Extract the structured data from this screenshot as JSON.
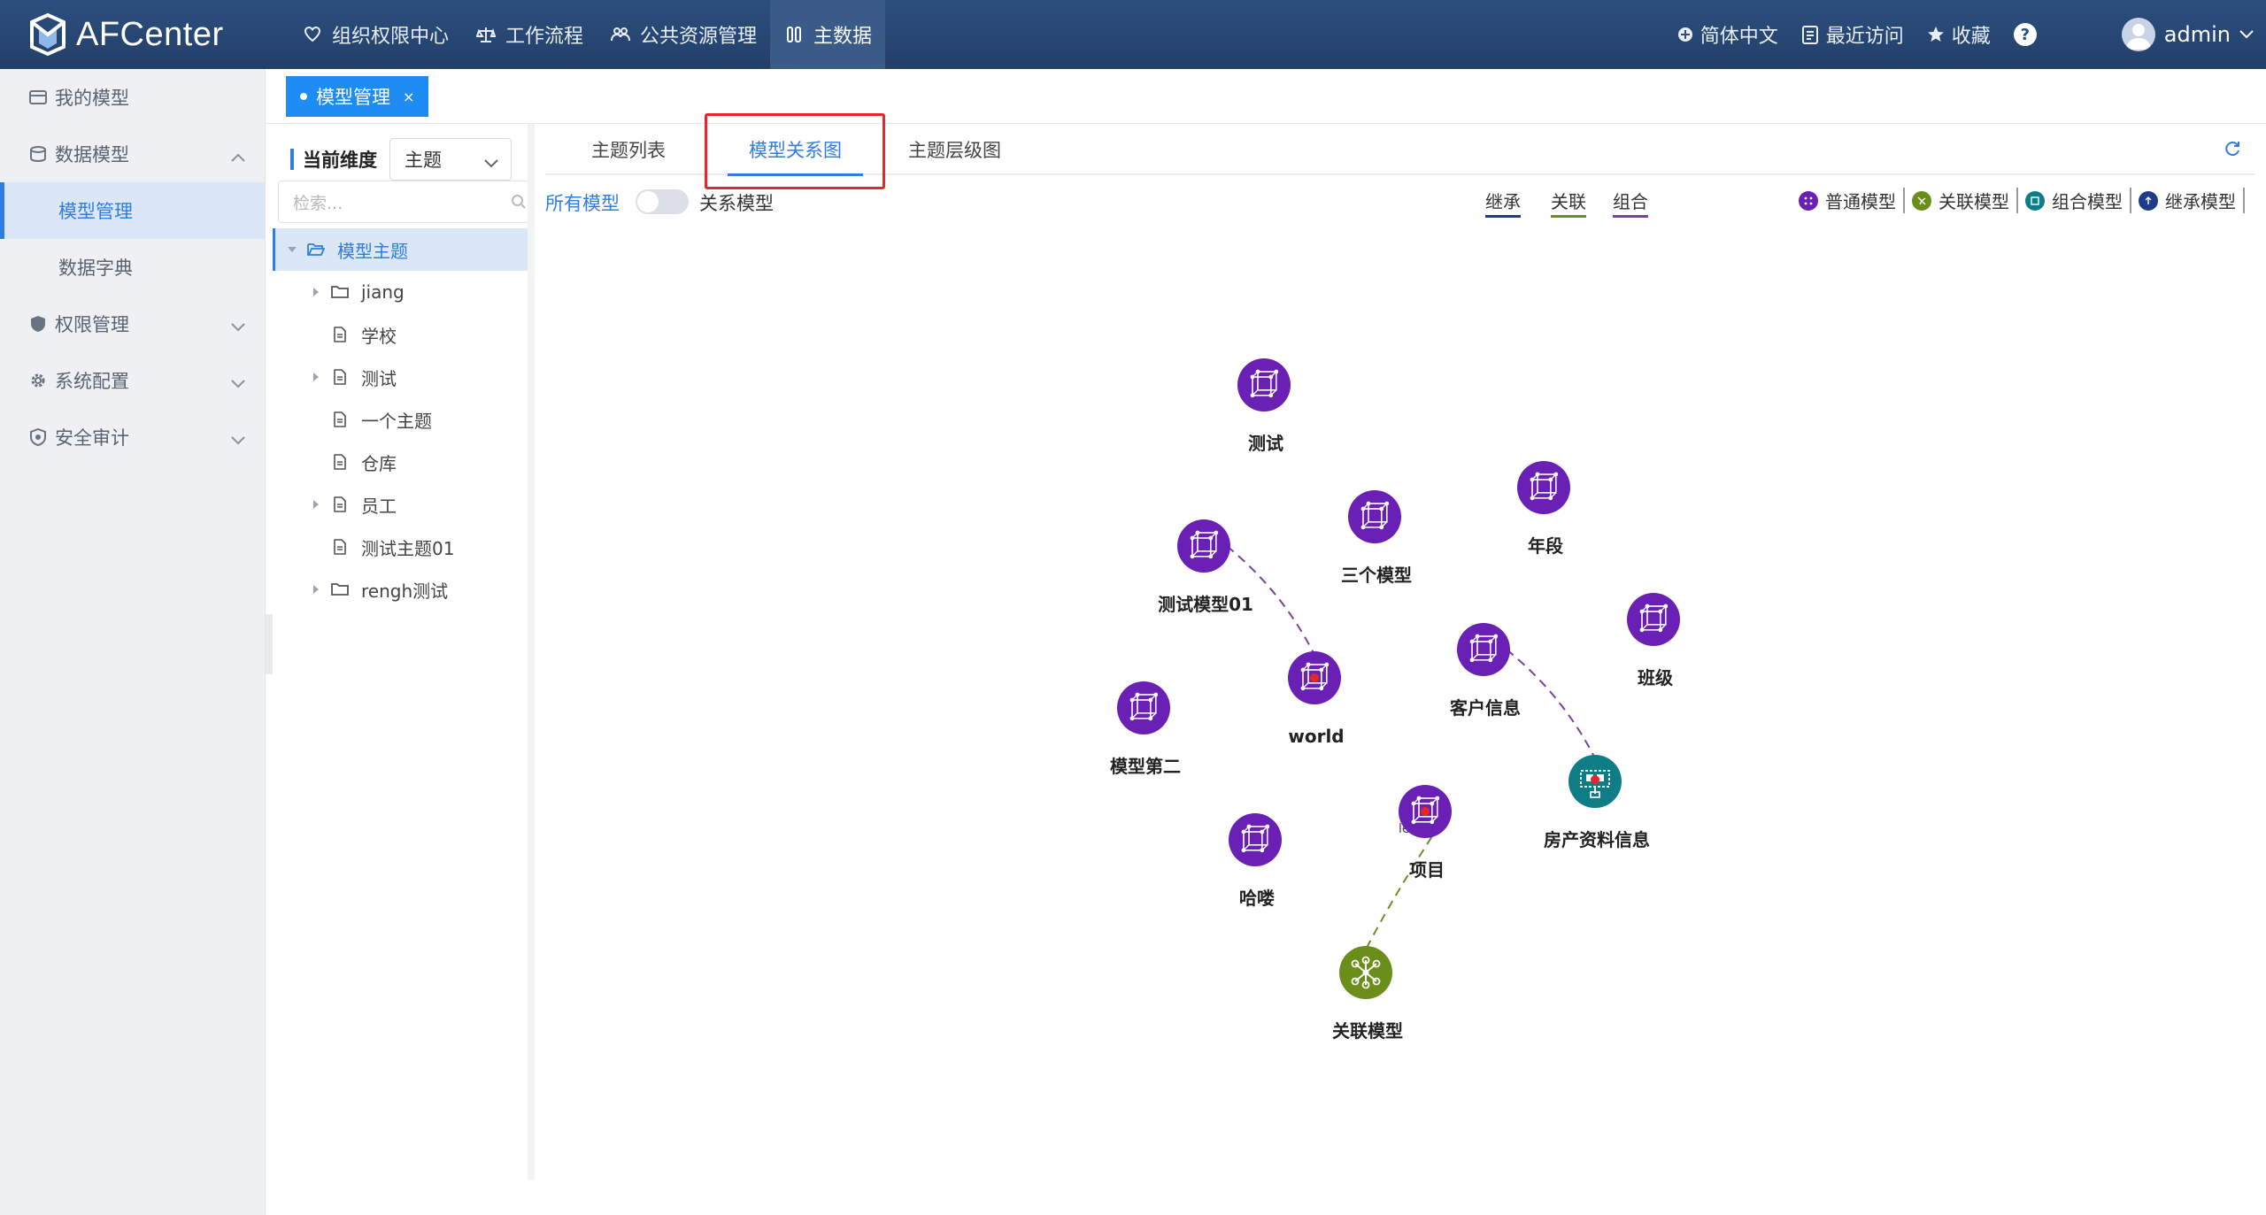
{
  "app": {
    "name": "AFCenter"
  },
  "topnav": {
    "items": [
      {
        "label": "组织权限中心",
        "icon": "heart-shield-icon"
      },
      {
        "label": "工作流程",
        "icon": "scale-icon"
      },
      {
        "label": "公共资源管理",
        "icon": "resources-icon"
      },
      {
        "label": "主数据",
        "icon": "master-data-icon",
        "active": true
      }
    ]
  },
  "topright": {
    "language": "简体中文",
    "recent": "最近访问",
    "favorites": "收藏",
    "help": "?",
    "user": "admin"
  },
  "sidebar": {
    "items": [
      {
        "label": "我的模型",
        "icon": "my-model-icon"
      },
      {
        "label": "数据模型",
        "icon": "data-model-icon",
        "expanded": true,
        "children": [
          {
            "label": "模型管理",
            "active": true
          },
          {
            "label": "数据字典"
          }
        ]
      },
      {
        "label": "权限管理",
        "icon": "shield-icon"
      },
      {
        "label": "系统配置",
        "icon": "gear-icon"
      },
      {
        "label": "安全审计",
        "icon": "audit-icon"
      }
    ]
  },
  "pagetab": {
    "label": "模型管理",
    "close": "×"
  },
  "treepanel": {
    "dimension_label": "当前维度",
    "dimension_value": "主题",
    "search_placeholder": "检索...",
    "root": "模型主题",
    "nodes": [
      {
        "label": "jiang",
        "type": "folder",
        "expandable": true
      },
      {
        "label": "学校",
        "type": "file",
        "expandable": false
      },
      {
        "label": "测试",
        "type": "file",
        "expandable": true
      },
      {
        "label": "一个主题",
        "type": "file",
        "expandable": false
      },
      {
        "label": "仓库",
        "type": "file",
        "expandable": false
      },
      {
        "label": "员工",
        "type": "file",
        "expandable": true
      },
      {
        "label": "测试主题01",
        "type": "file",
        "expandable": false
      },
      {
        "label": "rengh测试",
        "type": "folder",
        "expandable": true
      }
    ]
  },
  "subtabs": [
    {
      "label": "主题列表"
    },
    {
      "label": "模型关系图",
      "active": true
    },
    {
      "label": "主题层级图"
    }
  ],
  "toolbar": {
    "all_models": "所有模型",
    "relation_models": "关系模型",
    "relations": [
      {
        "label": "继承",
        "color": "#1f3c88"
      },
      {
        "label": "关联",
        "color": "#6b8e23"
      },
      {
        "label": "组合",
        "color": "#7b3fa0"
      }
    ]
  },
  "legend": [
    {
      "label": "普通模型",
      "color": "#6a1fb5"
    },
    {
      "label": "关联模型",
      "color": "#6b8e1a"
    },
    {
      "label": "组合模型",
      "color": "#0f7d85"
    },
    {
      "label": "继承模型",
      "color": "#1f3c88"
    }
  ],
  "graph": {
    "nodes": [
      {
        "label": "测试",
        "type": "normal"
      },
      {
        "label": "三个模型",
        "type": "normal"
      },
      {
        "label": "年段",
        "type": "normal"
      },
      {
        "label": "测试模型01",
        "type": "normal"
      },
      {
        "label": "world",
        "type": "normal"
      },
      {
        "label": "客户信息",
        "type": "normal"
      },
      {
        "label": "班级",
        "type": "normal"
      },
      {
        "label": "模型第二",
        "type": "normal"
      },
      {
        "label": "房产资料信息",
        "type": "composite"
      },
      {
        "label": "项目",
        "type": "normal"
      },
      {
        "label": "哈喽",
        "type": "normal"
      },
      {
        "label": "关联模型",
        "type": "association"
      }
    ],
    "edge_label": "level1",
    "colors": {
      "normal": "#6a1fb5",
      "association": "#6b8e1a",
      "composite": "#0f7d85",
      "link_normal": "#7b3fa0",
      "link_assoc": "#6b8e23"
    }
  }
}
